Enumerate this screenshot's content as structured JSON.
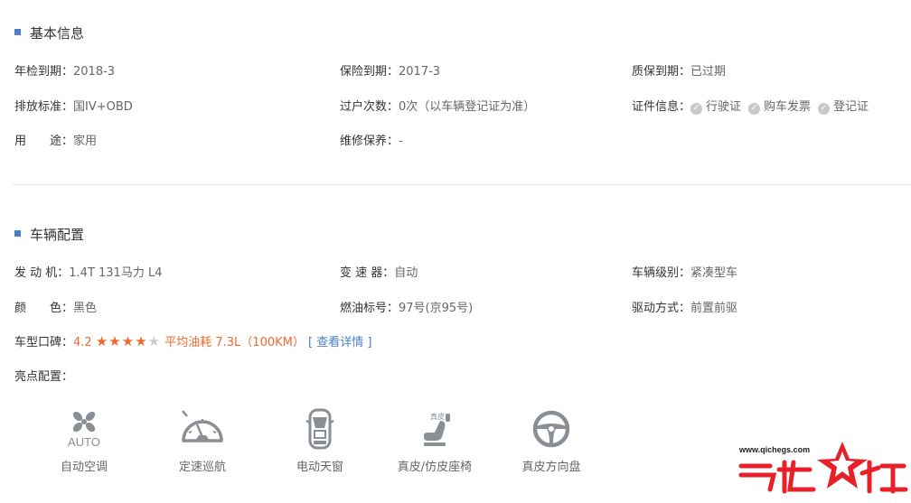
{
  "basic": {
    "title": "基本信息",
    "inspection_label": "年检到期：",
    "inspection_value": "2018-3",
    "insurance_label": "保险到期：",
    "insurance_value": "2017-3",
    "warranty_label": "质保到期：",
    "warranty_value": "已过期",
    "emission_label": "排放标准：",
    "emission_value": "国IV+OBD",
    "transfer_label": "过户次数：",
    "transfer_value": "0次（以车辆登记证为准）",
    "cert_label": "证件信息：",
    "certs": [
      "行驶证",
      "购车发票",
      "登记证"
    ],
    "usage_label": "用　　途：",
    "usage_value": "家用",
    "maintenance_label": "维修保养：",
    "maintenance_value": "-"
  },
  "config": {
    "title": "车辆配置",
    "engine_label": "发 动 机：",
    "engine_value": "1.4T 131马力 L4",
    "gearbox_label": "变 速 器：",
    "gearbox_value": "自动",
    "class_label": "车辆级别：",
    "class_value": "紧凑型车",
    "color_label": "颜　　色：",
    "color_value": "黑色",
    "fuel_label": "燃油标号：",
    "fuel_value": "97号(京95号)",
    "drive_label": "驱动方式：",
    "drive_value": "前置前驱",
    "rating_label": "车型口碑：",
    "rating_value": "4.2",
    "rating_stars": 4,
    "rating_max": 5,
    "fuel_consumption": "平均油耗 7.3L（100KM）",
    "details_link": "[ 查看详情 ]",
    "highlights_label": "亮点配置：",
    "highlights": [
      {
        "name": "自动空调",
        "icon": "auto-ac-icon",
        "icon_text": "AUTO"
      },
      {
        "name": "定速巡航",
        "icon": "cruise-control-icon"
      },
      {
        "name": "电动天窗",
        "icon": "sunroof-icon"
      },
      {
        "name": "真皮/仿皮座椅",
        "icon": "leather-seat-icon",
        "icon_text": "真皮"
      },
      {
        "name": "真皮方向盘",
        "icon": "steering-wheel-icon"
      }
    ]
  },
  "watermark": {
    "url": "www.qichegs.com",
    "brand": "汽车之杠"
  },
  "colors": {
    "accent_blue": "#4a7fc8",
    "rating_orange": "#ee6a2c",
    "icon_gray": "#8a8f96",
    "watermark_red": "#e8202a"
  }
}
